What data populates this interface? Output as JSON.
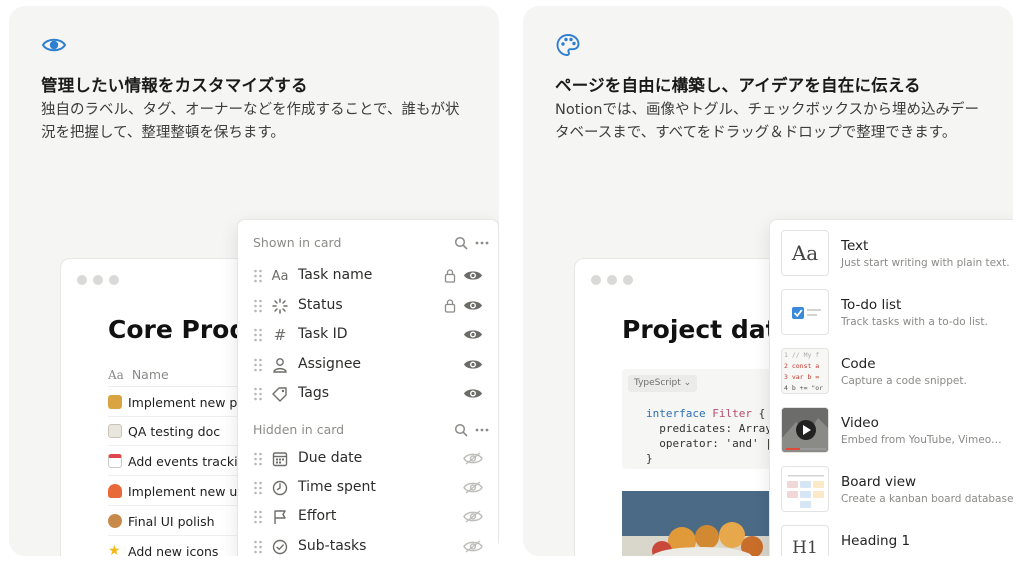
{
  "left_card": {
    "icon": "eye-icon",
    "title": "管理したい情報をカスタマイズする",
    "description": "独自のラベル、タグ、オーナーなどを作成することで、誰もが状況を把握して、整理整頓を保ちます。",
    "window": {
      "title": "Core Produ",
      "column_header": "Name",
      "column_header_icon": "Aa",
      "rows": [
        {
          "label": "Implement new perr",
          "icon": "lock-emoji"
        },
        {
          "label": "QA testing doc",
          "icon": "document-emoji"
        },
        {
          "label": "Add events tracking",
          "icon": "calendar-emoji"
        },
        {
          "label": "Implement new user",
          "icon": "runner-emoji"
        },
        {
          "label": "Final UI polish",
          "icon": "palette-emoji"
        },
        {
          "label": "Add new icons",
          "icon": "star-emoji"
        }
      ]
    },
    "panel": {
      "shown_label": "Shown in card",
      "hidden_label": "Hidden in card",
      "shown": [
        {
          "label": "Task name",
          "icon": "Aa",
          "locked": true
        },
        {
          "label": "Status",
          "icon": "status-icon",
          "locked": true
        },
        {
          "label": "Task ID",
          "icon": "#",
          "locked": false
        },
        {
          "label": "Assignee",
          "icon": "person-icon",
          "locked": false
        },
        {
          "label": "Tags",
          "icon": "tag-icon",
          "locked": false
        }
      ],
      "hidden": [
        {
          "label": "Due date",
          "icon": "calendar-icon"
        },
        {
          "label": "Time spent",
          "icon": "clock-icon"
        },
        {
          "label": "Effort",
          "icon": "flag-icon"
        },
        {
          "label": "Sub-tasks",
          "icon": "check-circle-icon"
        }
      ]
    }
  },
  "right_card": {
    "icon": "palette-icon",
    "title": "ページを自由に構築し、アイデアを自在に伝える",
    "description": "Notionでは、画像やトグル、チェックボックスから埋め込みデータベースまで、すべてをドラッグ＆ドロップで整理できます。",
    "window": {
      "title": "Project data",
      "code_language": "TypeScript",
      "code_lines": [
        {
          "kw": "interface ",
          "name": "Filter",
          "rest": " {"
        },
        {
          "kw": "",
          "name": "",
          "rest": "  predicates: Array"
        },
        {
          "kw": "",
          "name": "",
          "rest": "  operator: 'and' |"
        },
        {
          "kw": "",
          "name": "",
          "rest": "}"
        }
      ]
    },
    "blocks": [
      {
        "name": "Text",
        "desc": "Just start writing with plain text.",
        "thumb": "Aa"
      },
      {
        "name": "To-do list",
        "desc": "Track tasks with a to-do list.",
        "thumb": "checkbox"
      },
      {
        "name": "Code",
        "desc": "Capture a code snippet.",
        "thumb": "code"
      },
      {
        "name": "Video",
        "desc": "Embed from YouTube, Vimeo…",
        "thumb": "video"
      },
      {
        "name": "Board view",
        "desc": "Create a kanban board database v",
        "thumb": "board"
      },
      {
        "name": "Heading 1",
        "desc": "",
        "thumb": "H1"
      }
    ]
  },
  "colors": {
    "accent_blue": "#2f7fd0",
    "card_bg": "#f5f5f4",
    "eye_dark": "#6b6b68",
    "eye_light": "#bdbdba"
  }
}
